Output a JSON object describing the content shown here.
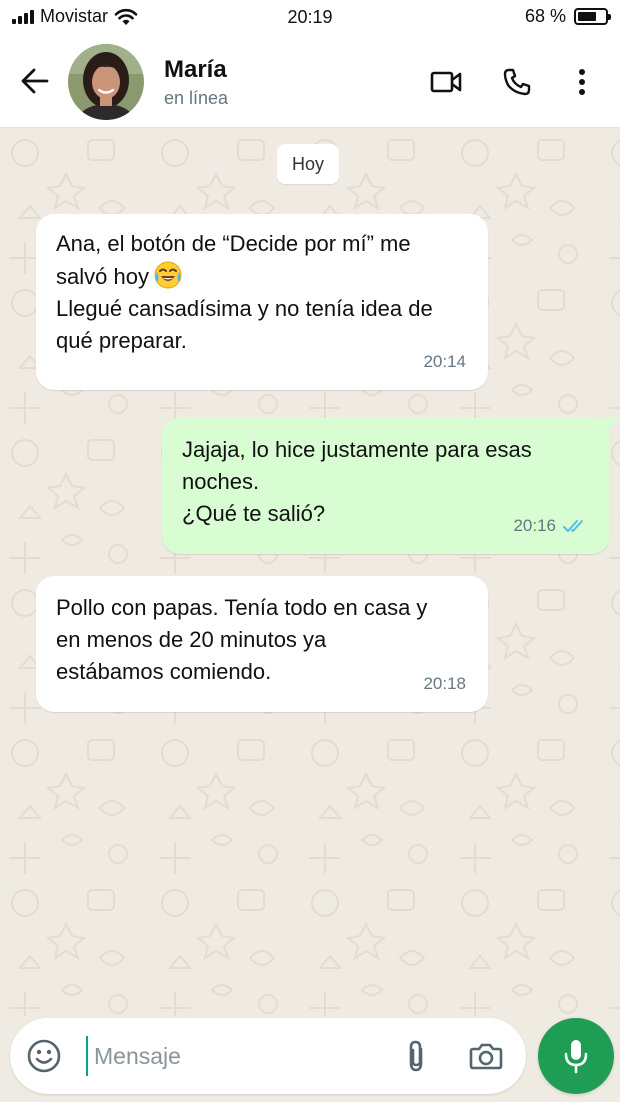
{
  "status_bar": {
    "carrier": "Movistar",
    "time": "20:19",
    "battery_percent": "68 %",
    "battery_level": 0.68
  },
  "header": {
    "contact_name": "María",
    "contact_status": "en línea",
    "icons": [
      "back-arrow-icon",
      "video-call-icon",
      "phone-call-icon",
      "more-options-icon"
    ]
  },
  "chat": {
    "date_label": "Hoy",
    "messages": [
      {
        "direction": "incoming",
        "text_before_emoji": "Ana, el botón de “Decide por mí” me\nsalvó hoy",
        "emoji": "face-with-tears-of-joy",
        "text_after_emoji": "Llegué cansadísima y no tenía idea de\nqué preparar.",
        "time": "20:14"
      },
      {
        "direction": "outgoing",
        "text": "Jajaja, lo hice justamente para esas\nnoches.\n¿Qué te salió?",
        "time": "20:16",
        "status": "read"
      },
      {
        "direction": "incoming",
        "text": "Pollo con papas. Tenía todo en casa y\nen menos de 20 minutos ya\nestábamos comiendo.",
        "time": "20:18"
      }
    ]
  },
  "input": {
    "placeholder": "Mensaje",
    "value": ""
  },
  "colors": {
    "outgoing_bubble": "#d9fdd3",
    "incoming_bubble": "#ffffff",
    "wallpaper": "#efeae2",
    "mic_button": "#1f9d55",
    "read_ticks": "#53bdeb"
  }
}
